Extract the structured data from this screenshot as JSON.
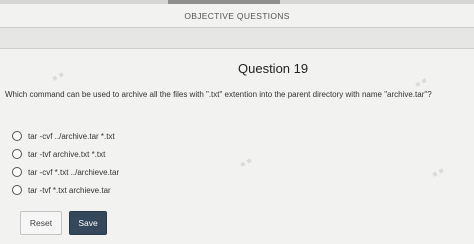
{
  "header": {
    "title": "OBJECTIVE QUESTIONS"
  },
  "question": {
    "title": "Question 19",
    "text": "Which command can be used to archive all the files with \".txt\" extention into the parent directory with name \"archive.tar\"?",
    "options": [
      "tar -cvf ../archive.tar *.txt",
      "tar -tvf archive.txt *.txt",
      "tar -cvf *.txt ../archieve.tar",
      "tar -tvf *.txt archieve.tar"
    ]
  },
  "buttons": {
    "reset_label": "Reset",
    "save_label": "Save"
  },
  "colors": {
    "save_button": "#35475a",
    "background": "#f2f2f0"
  }
}
